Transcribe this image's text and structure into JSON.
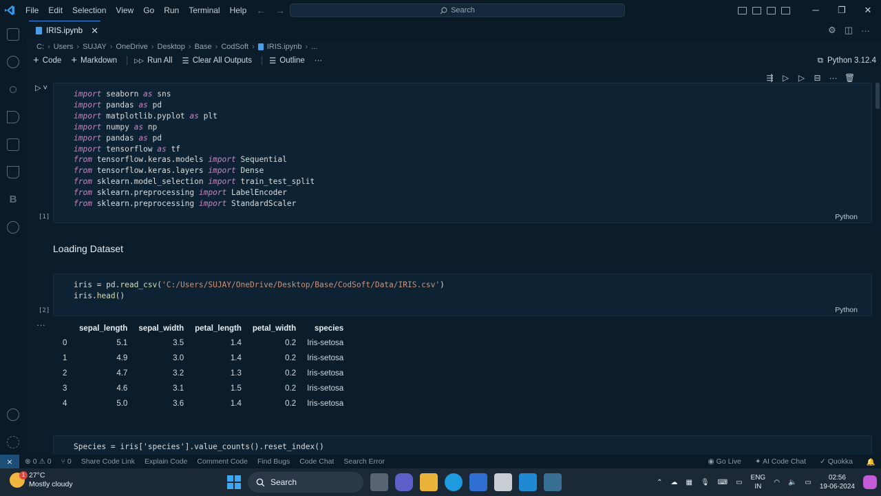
{
  "menu": [
    "File",
    "Edit",
    "Selection",
    "View",
    "Go",
    "Run",
    "Terminal",
    "Help"
  ],
  "search_placeholder": "Search",
  "tab": {
    "label": "IRIS.ipynb"
  },
  "breadcrumb": [
    "C:",
    "Users",
    "SUJAY",
    "OneDrive",
    "Desktop",
    "Base",
    "CodSoft",
    "IRIS.ipynb",
    "..."
  ],
  "toolbar": {
    "code": "Code",
    "markdown": "Markdown",
    "run_all": "Run All",
    "clear_outputs": "Clear All Outputs",
    "outline": "Outline",
    "more": "···",
    "kernel": "Python 3.12.4"
  },
  "cell1": {
    "exec_count": "[1]",
    "language": "Python"
  },
  "markdown_heading": "Loading Dataset",
  "cell2": {
    "exec_count": "[2]",
    "language": "Python"
  },
  "output_table": {
    "columns": [
      "",
      "sepal_length",
      "sepal_width",
      "petal_length",
      "petal_width",
      "species"
    ],
    "rows": [
      [
        "0",
        "5.1",
        "3.5",
        "1.4",
        "0.2",
        "Iris-setosa"
      ],
      [
        "1",
        "4.9",
        "3.0",
        "1.4",
        "0.2",
        "Iris-setosa"
      ],
      [
        "2",
        "4.7",
        "3.2",
        "1.3",
        "0.2",
        "Iris-setosa"
      ],
      [
        "3",
        "4.6",
        "3.1",
        "1.5",
        "0.2",
        "Iris-setosa"
      ],
      [
        "4",
        "5.0",
        "3.6",
        "1.4",
        "0.2",
        "Iris-setosa"
      ]
    ]
  },
  "cell3_line": "Species = iris['species'].value_counts().reset_index()",
  "statusbar": {
    "problems": "⊗ 0 ⚠ 0",
    "ports": "⑂ 0",
    "left_items": [
      "Share Code Link",
      "Explain Code",
      "Comment Code",
      "Find Bugs",
      "Code Chat",
      "Search Error"
    ],
    "go_live": "Go Live",
    "ai_chat": "AI Code Chat",
    "quokka": "Quokka"
  },
  "taskbar": {
    "weather_temp": "27°C",
    "weather_desc": "Mostly cloudy",
    "weather_badge": "1",
    "search": "Search",
    "lang_top": "ENG",
    "lang_bottom": "IN",
    "time": "02:56",
    "date": "19-06-2024"
  },
  "colors": {
    "accent": "#3a8ee6",
    "keyword": "#c586c0",
    "function": "#dcdcaa",
    "string": "#ce9178",
    "background": "#0b1d2a"
  }
}
